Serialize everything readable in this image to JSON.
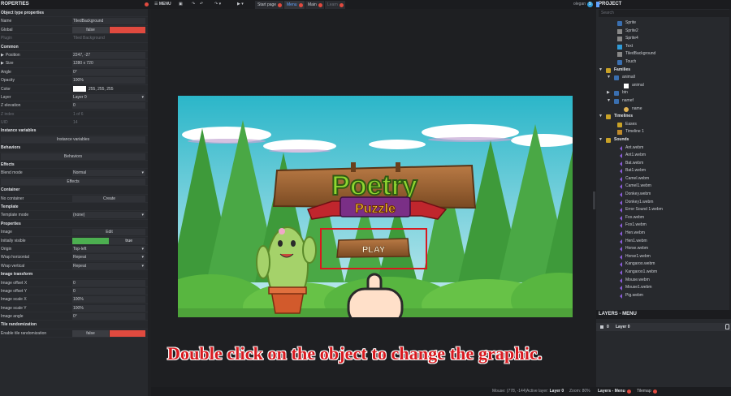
{
  "properties": {
    "title": "ROPERTIES",
    "sections": {
      "object_type": "Object type properties",
      "common": "Common",
      "instance_vars": "Instance variables",
      "behaviors": "Behaviors",
      "effects": "Effects",
      "container": "Container",
      "template": "Template",
      "properties": "Properties",
      "image_transform": "Image transform",
      "tile_rand": "Tile randomization"
    },
    "labels": {
      "name": "Name",
      "global": "Global",
      "plugin": "Plugin",
      "position": "Position",
      "size": "Size",
      "angle": "Angle",
      "opacity": "Opacity",
      "color": "Color",
      "layer": "Layer",
      "z_elevation": "Z elevation",
      "z_index": "Z index",
      "uid": "UID",
      "blend_mode": "Blend mode",
      "no_container": "No container",
      "template_mode": "Template mode",
      "image": "Image",
      "initially_visible": "Initially visible",
      "origin": "Origin",
      "wrap_h": "Wrap horizontal",
      "wrap_v": "Wrap vertical",
      "offset_x": "Image offset X",
      "offset_y": "Image offset Y",
      "scale_x": "Image scale X",
      "scale_y": "Image scale Y",
      "image_angle": "Image angle",
      "enable_tile_rand": "Enable tile randomization"
    },
    "values": {
      "name": "TiledBackground",
      "global": "false",
      "plugin": "Tiled Background",
      "position": "2247, -27",
      "size": "1280 x 720",
      "angle": "0°",
      "opacity": "100%",
      "color": "255, 255, 255",
      "layer": "Layer 0",
      "z_elevation": "0",
      "z_index": "1 of 6",
      "uid": "14",
      "blend_mode": "Normal",
      "template_mode": "(none)",
      "initially_visible": "true",
      "origin": "Top-left",
      "wrap_h": "Repeat",
      "wrap_v": "Repeat",
      "offset_x": "0",
      "offset_y": "0",
      "scale_x": "100%",
      "scale_y": "100%",
      "image_angle": "0°",
      "enable_tile_rand": "false"
    },
    "buttons": {
      "instance_vars": "Instance variables",
      "behaviors": "Behaviors",
      "effects": "Effects",
      "create": "Create",
      "edit": "Edit"
    },
    "initially_visible_fill": 0.5
  },
  "toolbar": {
    "menu_label": "MENU",
    "tabs": [
      "Start page",
      "Menu",
      "Main",
      "Learn"
    ],
    "active_tab": "Menu",
    "user": "olegan",
    "user_badge": "5"
  },
  "game": {
    "title_top": "Poetry",
    "title_bottom": "Puzzle",
    "play_label": "PLAY"
  },
  "caption": "Double click on the object to change the graphic.",
  "status": {
    "mouse_label": "Mouse:",
    "mouse_value": "(778, -144)",
    "active_layer_label": "Active layer:",
    "active_layer_value": "Layer 0",
    "zoom_label": "Zoom:",
    "zoom_value": "80%"
  },
  "project": {
    "title": "PROJECT",
    "search_placeholder": "Search",
    "items": [
      {
        "label": "Sprite",
        "kind": "obj",
        "indent": 26
      },
      {
        "label": "Sprite2",
        "kind": "ltgrey",
        "indent": 26
      },
      {
        "label": "Sprite4",
        "kind": "ltgrey",
        "indent": 26
      },
      {
        "label": "Text",
        "kind": "text",
        "indent": 26
      },
      {
        "label": "TiledBackground",
        "kind": "ltgrey",
        "indent": 26
      },
      {
        "label": "Touch",
        "kind": "obj",
        "indent": 26
      },
      {
        "label": "Families",
        "kind": "fold",
        "indent": 12,
        "folder": true,
        "open": true
      },
      {
        "label": "animall",
        "kind": "obj",
        "indent": 22,
        "open": true
      },
      {
        "label": "animal",
        "kind": "white",
        "indent": 34
      },
      {
        "label": "btn",
        "kind": "obj",
        "indent": 22,
        "closed": true
      },
      {
        "label": "namef",
        "kind": "obj",
        "indent": 22,
        "open": true
      },
      {
        "label": "name",
        "kind": "anim",
        "indent": 34
      },
      {
        "label": "Timelines",
        "kind": "fold",
        "indent": 12,
        "folder": true,
        "open": true
      },
      {
        "label": "Eases",
        "kind": "fold",
        "indent": 26
      },
      {
        "label": "Timeline 1",
        "kind": "tl",
        "indent": 26
      },
      {
        "label": "Sounds",
        "kind": "fold",
        "indent": 12,
        "folder": true,
        "open": true
      },
      {
        "label": "Ant.webm",
        "kind": "snd",
        "indent": 26
      },
      {
        "label": "Ant1.webm",
        "kind": "snd",
        "indent": 26
      },
      {
        "label": "Bat.webm",
        "kind": "snd",
        "indent": 26
      },
      {
        "label": "Bat1.webm",
        "kind": "snd",
        "indent": 26
      },
      {
        "label": "Camel.webm",
        "kind": "snd",
        "indent": 26
      },
      {
        "label": "Camel1.webm",
        "kind": "snd",
        "indent": 26
      },
      {
        "label": "Donkey.webm",
        "kind": "snd",
        "indent": 26
      },
      {
        "label": "Donkey1.webm",
        "kind": "snd",
        "indent": 26
      },
      {
        "label": "Error Sound 1.webm",
        "kind": "snd",
        "indent": 26
      },
      {
        "label": "Fox.webm",
        "kind": "snd",
        "indent": 26
      },
      {
        "label": "Fox1.webm",
        "kind": "snd",
        "indent": 26
      },
      {
        "label": "Hen.webm",
        "kind": "snd",
        "indent": 26
      },
      {
        "label": "Hen1.webm",
        "kind": "snd",
        "indent": 26
      },
      {
        "label": "Horse.webm",
        "kind": "snd",
        "indent": 26
      },
      {
        "label": "Horse1.webm",
        "kind": "snd",
        "indent": 26
      },
      {
        "label": "Kangaroo.webm",
        "kind": "snd",
        "indent": 26
      },
      {
        "label": "Kangaroo1.webm",
        "kind": "snd",
        "indent": 26
      },
      {
        "label": "Mouse.webm",
        "kind": "snd",
        "indent": 26
      },
      {
        "label": "Mouse1.webm",
        "kind": "snd",
        "indent": 26
      },
      {
        "label": "Pig.webm",
        "kind": "snd",
        "indent": 26
      }
    ]
  },
  "layers": {
    "title": "LAYERS - MENU",
    "rows": [
      {
        "num": "0",
        "name": "Layer 0"
      }
    ],
    "bottom_tabs": [
      "Layers - Menu",
      "Tilemap"
    ]
  },
  "colors": {
    "accent": "#62a3ff",
    "danger": "#e04a3f",
    "caption": "#d8191f"
  }
}
